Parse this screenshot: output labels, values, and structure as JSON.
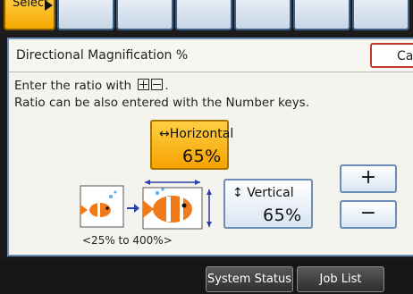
{
  "top_tabs": {
    "select_label": "Select",
    "cancel_label": "Cancel"
  },
  "panel": {
    "title": "Directional Magnification %",
    "instruction_line1": "Enter the ratio with",
    "instruction_line2": "Ratio can be also entered with the Number keys.",
    "horizontal": {
      "label": "Horizontal",
      "value": "65%"
    },
    "vertical": {
      "label": "Vertical",
      "value": "65%"
    },
    "plus_label": "+",
    "minus_label": "−",
    "range_text": "<25% to 400%>"
  },
  "footer": {
    "system_status_label": "System Status",
    "job_list_label": "Job List"
  },
  "colors": {
    "accent": "#f5a300",
    "panel_border": "#6d8fb6",
    "cancel_border": "#c0392b"
  }
}
